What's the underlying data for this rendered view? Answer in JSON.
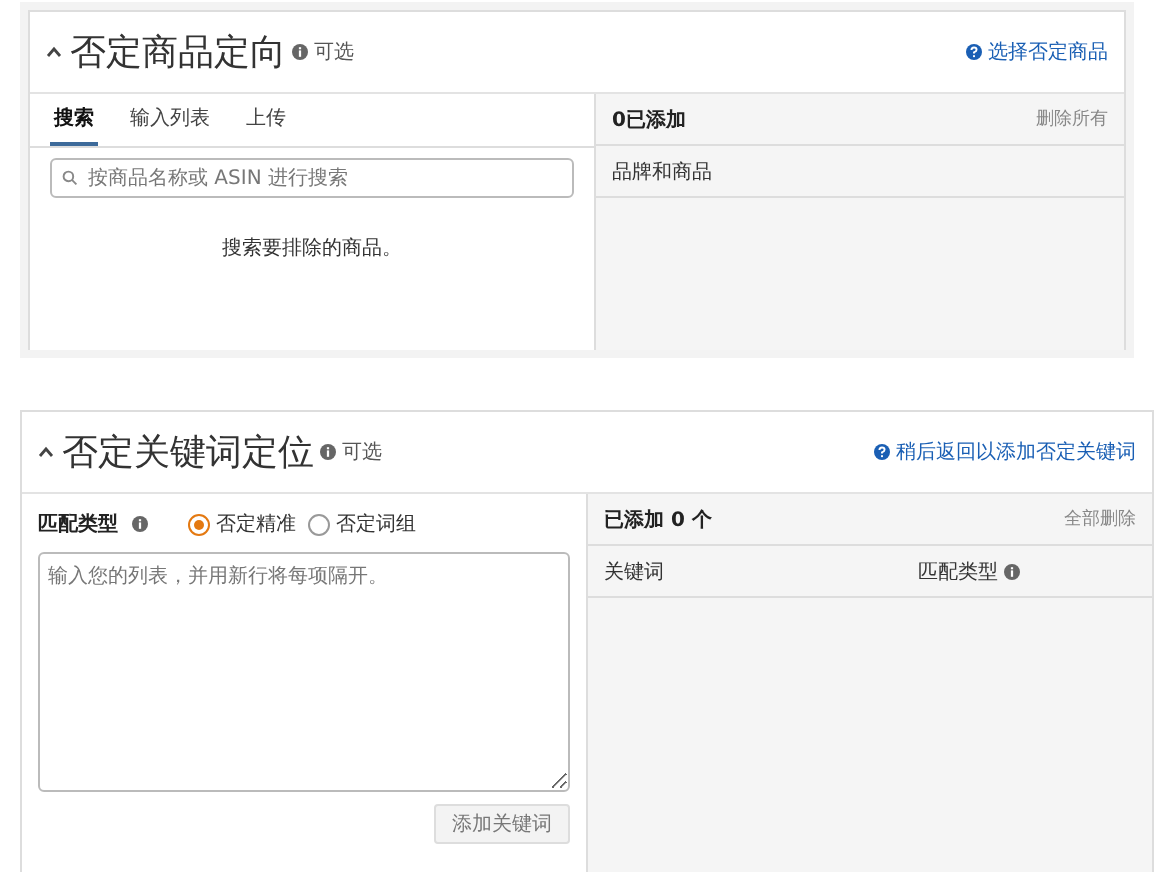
{
  "sections": [
    {
      "kind": "products",
      "title": "否定商品定向",
      "optional": "可选",
      "help_link": "选择否定商品",
      "tabs": [
        {
          "label": "搜索",
          "selected": true
        },
        {
          "label": "输入列表",
          "selected": false
        },
        {
          "label": "上传",
          "selected": false
        }
      ],
      "search": {
        "placeholder": "按商品名称或 ASIN 进行搜索"
      },
      "empty_message": "搜索要排除的商品。",
      "added": {
        "count_label": "0已添加",
        "remove_all": "删除所有",
        "columns": [
          {
            "label": "品牌和商品",
            "info": false
          }
        ]
      }
    },
    {
      "kind": "keywords",
      "title": "否定关键词定位",
      "optional": "可选",
      "help_link": "稍后返回以添加否定关键词",
      "match_type": {
        "label": "匹配类型",
        "options": [
          {
            "label": "否定精准",
            "selected": true
          },
          {
            "label": "否定词组",
            "selected": false
          }
        ]
      },
      "keyword_input": {
        "placeholder": "输入您的列表，并用新行将每项隔开。"
      },
      "add_button": "添加关键词",
      "added": {
        "count_label": "已添加 0 个",
        "remove_all": "全部删除",
        "columns": [
          {
            "label": "关键词",
            "info": false
          },
          {
            "label": "匹配类型",
            "info": true
          }
        ]
      }
    }
  ]
}
